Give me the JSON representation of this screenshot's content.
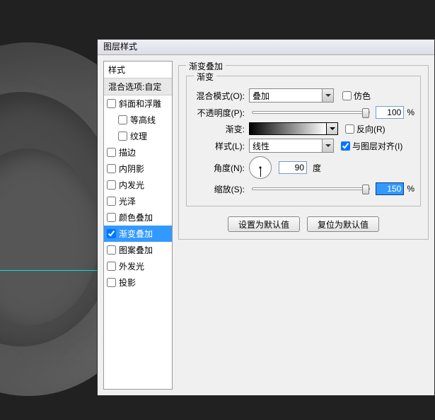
{
  "dialog": {
    "title": "图层样式"
  },
  "styles": {
    "header": "样式",
    "blend_opts": "混合选项:自定",
    "items": [
      {
        "label": "斜面和浮雕",
        "checked": false,
        "indent": false
      },
      {
        "label": "等高线",
        "checked": false,
        "indent": true
      },
      {
        "label": "纹理",
        "checked": false,
        "indent": true
      },
      {
        "label": "描边",
        "checked": false,
        "indent": false
      },
      {
        "label": "内阴影",
        "checked": false,
        "indent": false
      },
      {
        "label": "内发光",
        "checked": false,
        "indent": false
      },
      {
        "label": "光泽",
        "checked": false,
        "indent": false
      },
      {
        "label": "颜色叠加",
        "checked": false,
        "indent": false
      },
      {
        "label": "渐变叠加",
        "checked": true,
        "indent": false,
        "selected": true
      },
      {
        "label": "图案叠加",
        "checked": false,
        "indent": false
      },
      {
        "label": "外发光",
        "checked": false,
        "indent": false
      },
      {
        "label": "投影",
        "checked": false,
        "indent": false
      }
    ]
  },
  "panel": {
    "group_title": "渐变叠加",
    "inner_title": "渐变",
    "blend_mode_label": "混合模式(O):",
    "blend_mode_value": "叠加",
    "dither_label": "仿色",
    "opacity_label": "不透明度(P):",
    "opacity_value": "100",
    "pct": "%",
    "gradient_label": "渐变:",
    "reverse_label": "反向(R)",
    "style_label": "样式(L):",
    "style_value": "线性",
    "align_label": "与图层对齐(I)",
    "angle_label": "角度(N):",
    "angle_value": "90",
    "deg": "度",
    "scale_label": "缩放(S):",
    "scale_value": "150",
    "btn_default": "设置为默认值",
    "btn_reset": "复位为默认值"
  }
}
